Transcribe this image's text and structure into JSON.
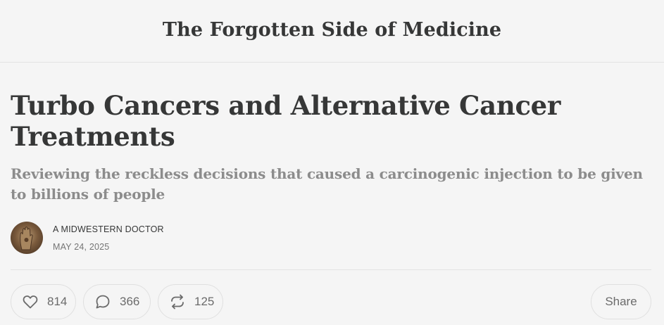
{
  "publication": {
    "title": "The Forgotten Side of Medicine"
  },
  "post": {
    "title": "Turbo Cancers and Alternative Cancer Treatments",
    "subtitle": "Reviewing the reckless decisions that caused a carcinogenic injection to be given to billions of people",
    "author": "A MIDWESTERN DOCTOR",
    "date": "MAY 24, 2025"
  },
  "actions": {
    "likes": "814",
    "comments": "366",
    "restacks": "125",
    "share_label": "Share"
  },
  "icons": {
    "like": "heart-icon",
    "comment": "comment-bubble-icon",
    "restack": "restack-arrows-icon",
    "avatar": "hand-sculpture-avatar"
  }
}
